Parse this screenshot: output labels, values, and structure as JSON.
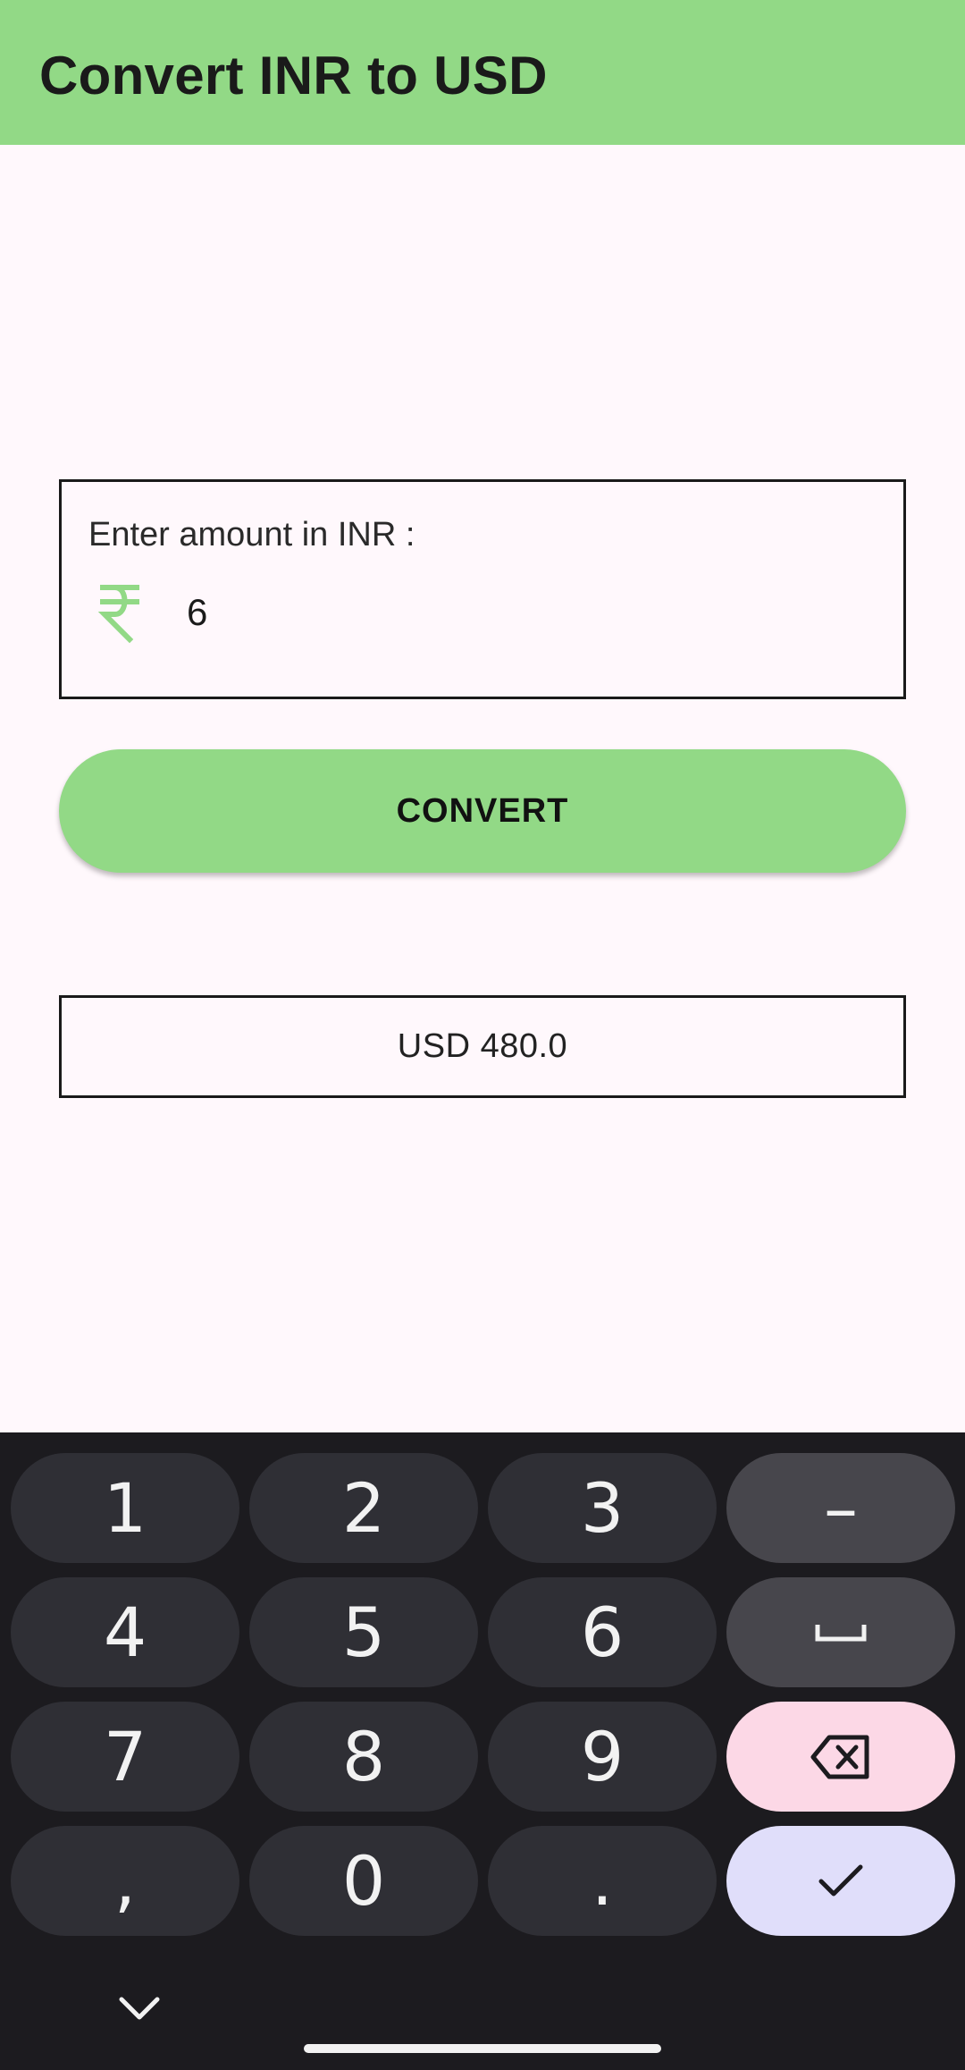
{
  "appbar": {
    "title": "Convert INR to USD",
    "color": "#92D986"
  },
  "input": {
    "label": "Enter amount in INR :",
    "value": "6",
    "icon": "rupee-icon"
  },
  "convert_button": {
    "label": "CONVERT"
  },
  "result": {
    "text": "USD 480.0"
  },
  "keyboard": {
    "keys": {
      "k1": "1",
      "k2": "2",
      "k3": "3",
      "minus": "–",
      "k4": "4",
      "k5": "5",
      "k6": "6",
      "k7": "7",
      "k8": "8",
      "k9": "9",
      "comma": ",",
      "k0": "0",
      "period": "."
    },
    "icons": [
      "space-icon",
      "backspace-icon",
      "check-icon",
      "chevron-down-icon"
    ]
  }
}
